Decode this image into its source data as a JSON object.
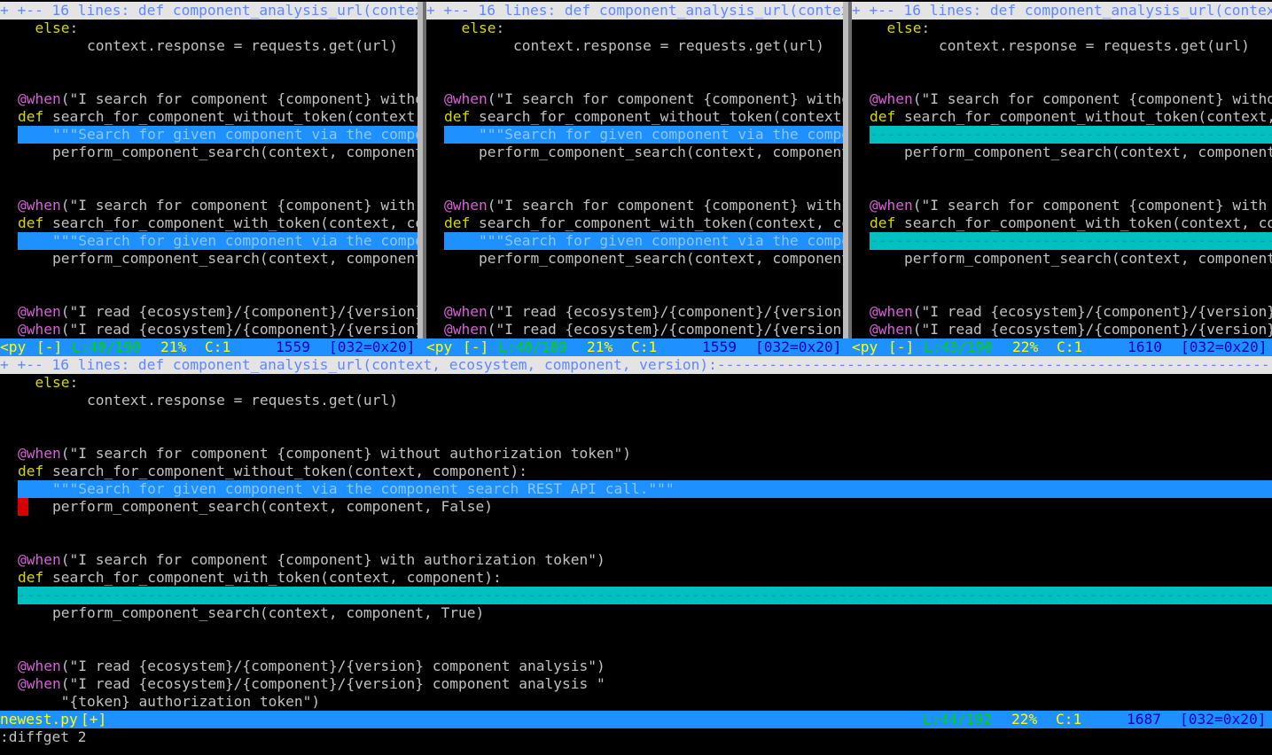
{
  "fold_text": "+ +-- 16 lines: def component_analysis_url(context, ecosystem, component, version):",
  "dash_fill": "---------------------------------------------------------------------------------------------------------------------------------------------",
  "code": {
    "else": "else",
    "colon": ":",
    "response": "        context.response = requests.get(url)",
    "dec_at": "@",
    "when_kw": "when",
    "when1": "(\"I search for component {component} without authorization token\")",
    "def_kw": "def",
    "def1": " search_for_component_without_token(context, component):",
    "doc1": "    \"\"\"Search for given component via the component search REST API call.\"\"\"",
    "call1": "    perform_component_search(context, component, False)",
    "when2": "(\"I search for component {component} with authorization token\")",
    "def2": " search_for_component_with_token(context, component):",
    "doc2": "    \"\"\"Search for given component via the component search REST API call.\"\"\"",
    "call2": "    perform_component_search(context, component, True)",
    "when3": "(\"I read {ecosystem}/{component}/{version} component analysis\")",
    "when4": "(\"I read {ecosystem}/{component}/{version} component analysis \"",
    "cont4": "     \"{token} authorization token\")"
  },
  "panes": [
    {
      "filetype": "<py",
      "modified": "[-]",
      "line": "L:40/190",
      "percent": "21%",
      "col": "C:1",
      "offset": "1559",
      "char": "[032=0x20]"
    },
    {
      "filetype": "<py",
      "modified": "[-]",
      "line": "L:40/189",
      "percent": "21%",
      "col": "C:1",
      "offset": "1559",
      "char": "[032=0x20]"
    },
    {
      "filetype": "<py",
      "modified": "[-]",
      "line": "L:43/190",
      "percent": "22%",
      "col": "C:1",
      "offset": "1610",
      "char": "[032=0x20]"
    }
  ],
  "main_status": {
    "filename": "newest.py",
    "modified": "[+]",
    "line": "L:44/192",
    "percent": "22%",
    "col": "C:1",
    "offset": "1687",
    "char": "[032=0x20]"
  },
  "command_line": ":diffget 2"
}
